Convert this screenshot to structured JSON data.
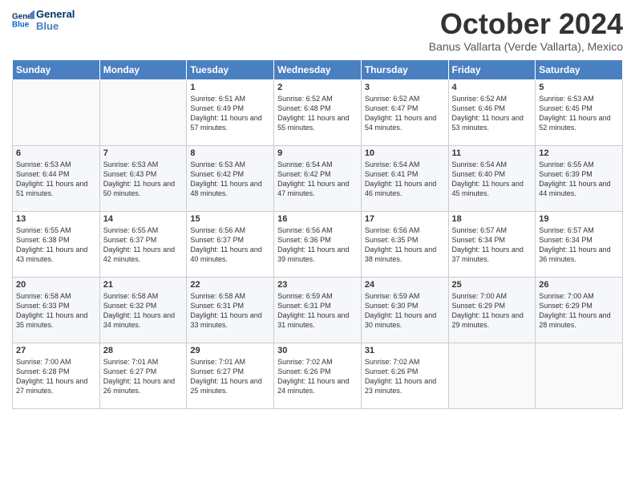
{
  "header": {
    "title": "October 2024",
    "subtitle": "Banus Vallarta (Verde Vallarta), Mexico"
  },
  "columns": [
    "Sunday",
    "Monday",
    "Tuesday",
    "Wednesday",
    "Thursday",
    "Friday",
    "Saturday"
  ],
  "weeks": [
    [
      {
        "day": "",
        "sunrise": "",
        "sunset": "",
        "daylight": ""
      },
      {
        "day": "",
        "sunrise": "",
        "sunset": "",
        "daylight": ""
      },
      {
        "day": "1",
        "sunrise": "Sunrise: 6:51 AM",
        "sunset": "Sunset: 6:49 PM",
        "daylight": "Daylight: 11 hours and 57 minutes."
      },
      {
        "day": "2",
        "sunrise": "Sunrise: 6:52 AM",
        "sunset": "Sunset: 6:48 PM",
        "daylight": "Daylight: 11 hours and 55 minutes."
      },
      {
        "day": "3",
        "sunrise": "Sunrise: 6:52 AM",
        "sunset": "Sunset: 6:47 PM",
        "daylight": "Daylight: 11 hours and 54 minutes."
      },
      {
        "day": "4",
        "sunrise": "Sunrise: 6:52 AM",
        "sunset": "Sunset: 6:46 PM",
        "daylight": "Daylight: 11 hours and 53 minutes."
      },
      {
        "day": "5",
        "sunrise": "Sunrise: 6:53 AM",
        "sunset": "Sunset: 6:45 PM",
        "daylight": "Daylight: 11 hours and 52 minutes."
      }
    ],
    [
      {
        "day": "6",
        "sunrise": "Sunrise: 6:53 AM",
        "sunset": "Sunset: 6:44 PM",
        "daylight": "Daylight: 11 hours and 51 minutes."
      },
      {
        "day": "7",
        "sunrise": "Sunrise: 6:53 AM",
        "sunset": "Sunset: 6:43 PM",
        "daylight": "Daylight: 11 hours and 50 minutes."
      },
      {
        "day": "8",
        "sunrise": "Sunrise: 6:53 AM",
        "sunset": "Sunset: 6:42 PM",
        "daylight": "Daylight: 11 hours and 48 minutes."
      },
      {
        "day": "9",
        "sunrise": "Sunrise: 6:54 AM",
        "sunset": "Sunset: 6:42 PM",
        "daylight": "Daylight: 11 hours and 47 minutes."
      },
      {
        "day": "10",
        "sunrise": "Sunrise: 6:54 AM",
        "sunset": "Sunset: 6:41 PM",
        "daylight": "Daylight: 11 hours and 46 minutes."
      },
      {
        "day": "11",
        "sunrise": "Sunrise: 6:54 AM",
        "sunset": "Sunset: 6:40 PM",
        "daylight": "Daylight: 11 hours and 45 minutes."
      },
      {
        "day": "12",
        "sunrise": "Sunrise: 6:55 AM",
        "sunset": "Sunset: 6:39 PM",
        "daylight": "Daylight: 11 hours and 44 minutes."
      }
    ],
    [
      {
        "day": "13",
        "sunrise": "Sunrise: 6:55 AM",
        "sunset": "Sunset: 6:38 PM",
        "daylight": "Daylight: 11 hours and 43 minutes."
      },
      {
        "day": "14",
        "sunrise": "Sunrise: 6:55 AM",
        "sunset": "Sunset: 6:37 PM",
        "daylight": "Daylight: 11 hours and 42 minutes."
      },
      {
        "day": "15",
        "sunrise": "Sunrise: 6:56 AM",
        "sunset": "Sunset: 6:37 PM",
        "daylight": "Daylight: 11 hours and 40 minutes."
      },
      {
        "day": "16",
        "sunrise": "Sunrise: 6:56 AM",
        "sunset": "Sunset: 6:36 PM",
        "daylight": "Daylight: 11 hours and 39 minutes."
      },
      {
        "day": "17",
        "sunrise": "Sunrise: 6:56 AM",
        "sunset": "Sunset: 6:35 PM",
        "daylight": "Daylight: 11 hours and 38 minutes."
      },
      {
        "day": "18",
        "sunrise": "Sunrise: 6:57 AM",
        "sunset": "Sunset: 6:34 PM",
        "daylight": "Daylight: 11 hours and 37 minutes."
      },
      {
        "day": "19",
        "sunrise": "Sunrise: 6:57 AM",
        "sunset": "Sunset: 6:34 PM",
        "daylight": "Daylight: 11 hours and 36 minutes."
      }
    ],
    [
      {
        "day": "20",
        "sunrise": "Sunrise: 6:58 AM",
        "sunset": "Sunset: 6:33 PM",
        "daylight": "Daylight: 11 hours and 35 minutes."
      },
      {
        "day": "21",
        "sunrise": "Sunrise: 6:58 AM",
        "sunset": "Sunset: 6:32 PM",
        "daylight": "Daylight: 11 hours and 34 minutes."
      },
      {
        "day": "22",
        "sunrise": "Sunrise: 6:58 AM",
        "sunset": "Sunset: 6:31 PM",
        "daylight": "Daylight: 11 hours and 33 minutes."
      },
      {
        "day": "23",
        "sunrise": "Sunrise: 6:59 AM",
        "sunset": "Sunset: 6:31 PM",
        "daylight": "Daylight: 11 hours and 31 minutes."
      },
      {
        "day": "24",
        "sunrise": "Sunrise: 6:59 AM",
        "sunset": "Sunset: 6:30 PM",
        "daylight": "Daylight: 11 hours and 30 minutes."
      },
      {
        "day": "25",
        "sunrise": "Sunrise: 7:00 AM",
        "sunset": "Sunset: 6:29 PM",
        "daylight": "Daylight: 11 hours and 29 minutes."
      },
      {
        "day": "26",
        "sunrise": "Sunrise: 7:00 AM",
        "sunset": "Sunset: 6:29 PM",
        "daylight": "Daylight: 11 hours and 28 minutes."
      }
    ],
    [
      {
        "day": "27",
        "sunrise": "Sunrise: 7:00 AM",
        "sunset": "Sunset: 6:28 PM",
        "daylight": "Daylight: 11 hours and 27 minutes."
      },
      {
        "day": "28",
        "sunrise": "Sunrise: 7:01 AM",
        "sunset": "Sunset: 6:27 PM",
        "daylight": "Daylight: 11 hours and 26 minutes."
      },
      {
        "day": "29",
        "sunrise": "Sunrise: 7:01 AM",
        "sunset": "Sunset: 6:27 PM",
        "daylight": "Daylight: 11 hours and 25 minutes."
      },
      {
        "day": "30",
        "sunrise": "Sunrise: 7:02 AM",
        "sunset": "Sunset: 6:26 PM",
        "daylight": "Daylight: 11 hours and 24 minutes."
      },
      {
        "day": "31",
        "sunrise": "Sunrise: 7:02 AM",
        "sunset": "Sunset: 6:26 PM",
        "daylight": "Daylight: 11 hours and 23 minutes."
      },
      {
        "day": "",
        "sunrise": "",
        "sunset": "",
        "daylight": ""
      },
      {
        "day": "",
        "sunrise": "",
        "sunset": "",
        "daylight": ""
      }
    ]
  ]
}
